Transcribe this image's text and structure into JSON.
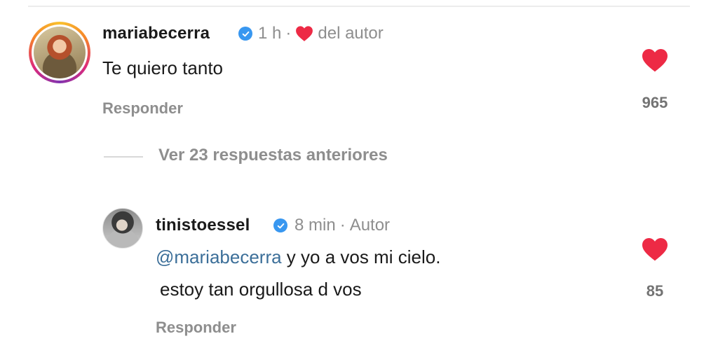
{
  "comment": {
    "username": "mariabecerra",
    "time": "1 h",
    "separator": "·",
    "liked_by_author": "del autor",
    "text": "Te quiero tanto",
    "reply_label": "Responder",
    "likes": "965"
  },
  "view_previous": {
    "label": "Ver 23 respuestas anteriores"
  },
  "reply": {
    "username": "tinistoessel",
    "time": "8 min",
    "separator": "·",
    "role": "Autor",
    "mention": "@mariabecerra",
    "text_line1": " y yo a vos mi cielo.",
    "text_line2": "estoy tan orgullosa d vos",
    "reply_label": "Responder",
    "likes": "85"
  },
  "colors": {
    "heart": "#ed2a45",
    "verified": "#3897f0",
    "muted_text": "#8e8e8e",
    "mention": "#3c6f99"
  },
  "icons": {
    "verified": "verified-badge-icon",
    "like": "heart-icon"
  }
}
